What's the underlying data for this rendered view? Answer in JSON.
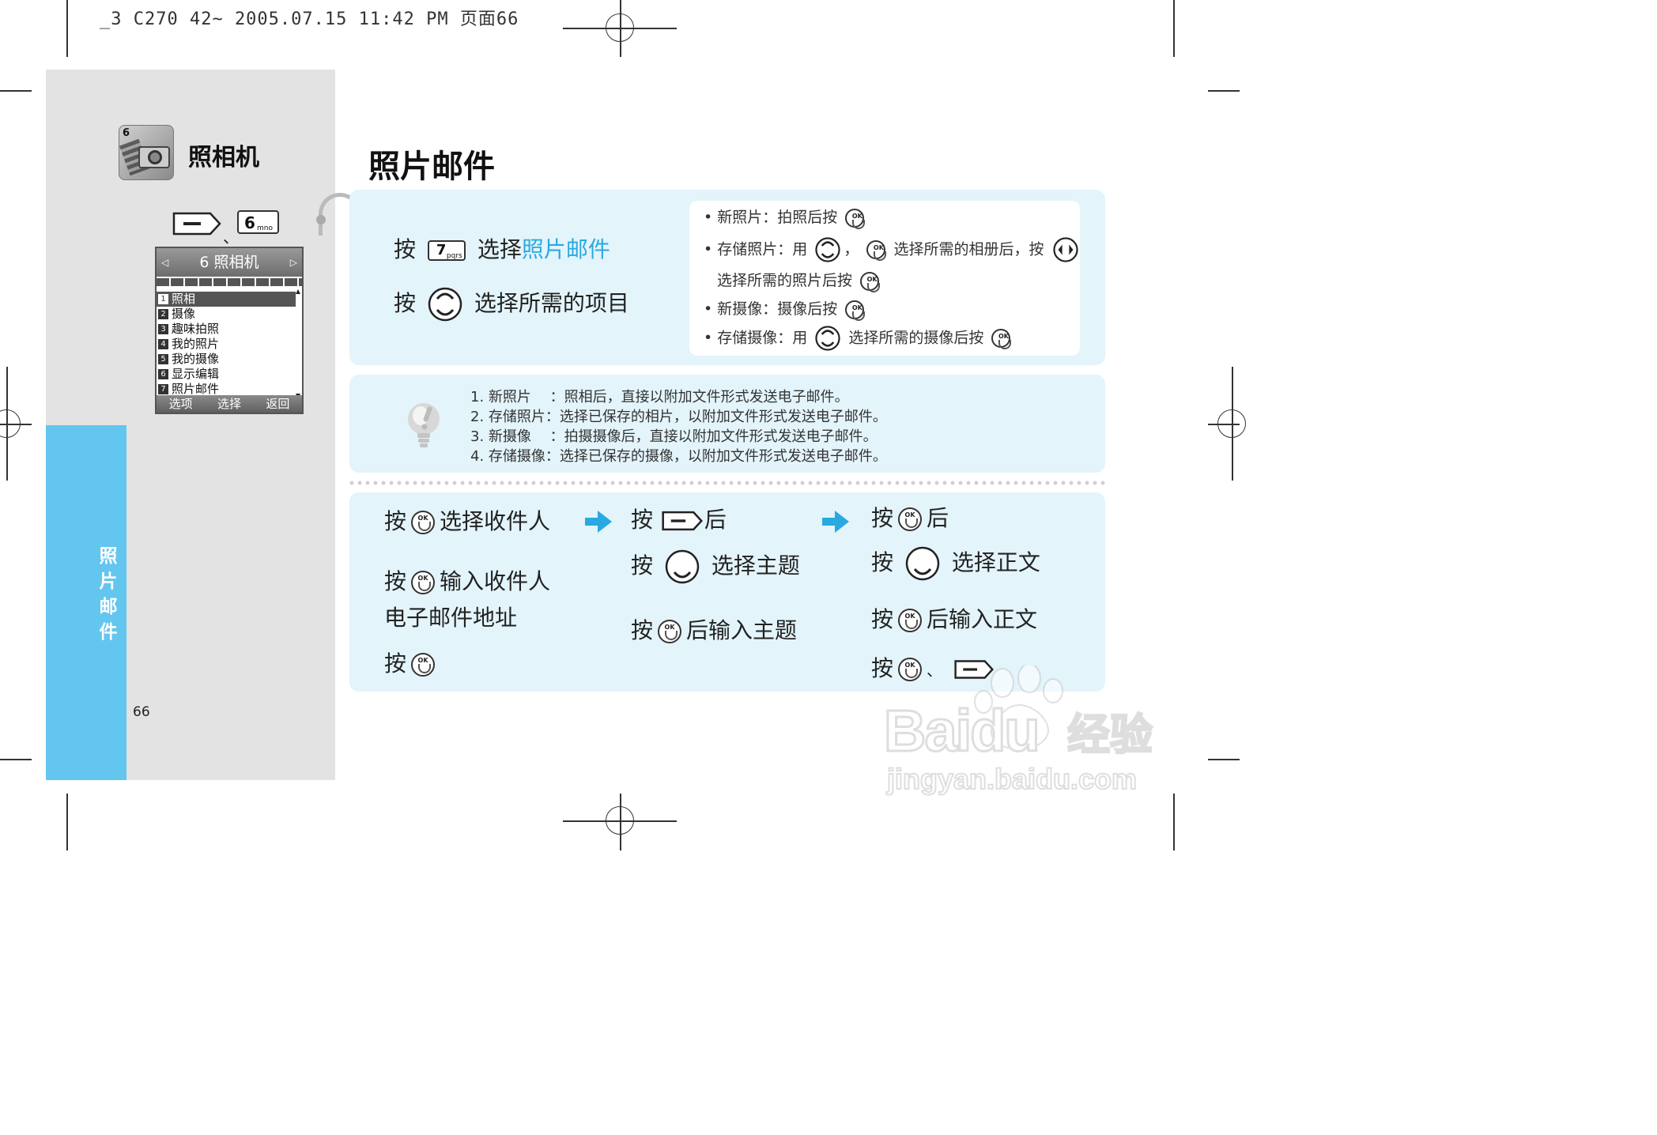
{
  "print_header": "_3 C270 42~ 2005.07.15 11:42 PM 页面66",
  "sidebar": {
    "section_title": "照相机",
    "icon_number": "6",
    "separator": "、",
    "num_key": {
      "digit": "6",
      "letters": "mno"
    },
    "tab_label": "照片邮件",
    "page_number": "66"
  },
  "phone_screen": {
    "header": "6 照相机",
    "items": [
      {
        "n": "1",
        "label": "照相"
      },
      {
        "n": "2",
        "label": "摄像"
      },
      {
        "n": "3",
        "label": "趣味拍照"
      },
      {
        "n": "4",
        "label": "我的照片"
      },
      {
        "n": "5",
        "label": "我的摄像"
      },
      {
        "n": "6",
        "label": "显示编辑"
      },
      {
        "n": "7",
        "label": "照片邮件"
      }
    ],
    "selected_index": 0,
    "footer": {
      "left": "选项",
      "center": "选择",
      "right": "返回"
    }
  },
  "main": {
    "title": "照片邮件",
    "step1": {
      "prefix": "按",
      "key_digit": "7",
      "key_letters": "pqrs",
      "text": "选择",
      "highlight": "照片邮件"
    },
    "step2": {
      "prefix": "按",
      "text": "选择所需的项目"
    },
    "bullets": [
      {
        "a": "新照片：拍照后按"
      },
      {
        "a": "存储照片：用",
        "b": "，",
        "c": "选择所需的相册后，按",
        "d": "选择所需的照片后按"
      },
      {
        "a": "新摄像：摄像后按"
      },
      {
        "a": "存储摄像：用",
        "b": "选择所需的摄像后按"
      }
    ],
    "bullet_symbol": "•",
    "notes": [
      "1. 新照片　 ：照相后，直接以附加文件形式发送电子邮件。",
      "2. 存储照片：选择已保存的相片，以附加文件形式发送电子邮件。",
      "3. 新摄像　 ：拍摄摄像后，直接以附加文件形式发送电子邮件。",
      "4. 存储摄像：选择已保存的摄像，以附加文件形式发送电子邮件。"
    ],
    "col1": {
      "l1a": "按",
      "l1b": "选择收件人",
      "l2a": "按",
      "l2b": "输入收件人",
      "l3": "电子邮件地址",
      "l4": "按"
    },
    "col2": {
      "l1a": "按",
      "l1b": "后",
      "l2a": "按",
      "l2b": "选择主题",
      "l3a": "按",
      "l3b": "后输入主题"
    },
    "col3": {
      "l1a": "按",
      "l1b": "后",
      "l2a": "按",
      "l2b": "选择正文",
      "l3a": "按",
      "l3b": "后输入正文",
      "l4a": "按",
      "l4b": "、"
    }
  },
  "watermark": {
    "brand": "Baidu",
    "suffix": "经验",
    "url": "jingyan.baidu.com"
  },
  "colors": {
    "accent": "#29a9e0",
    "tab": "#63c6ef",
    "panel": "#e3f4fb",
    "sidebar": "#e3e3e3"
  }
}
